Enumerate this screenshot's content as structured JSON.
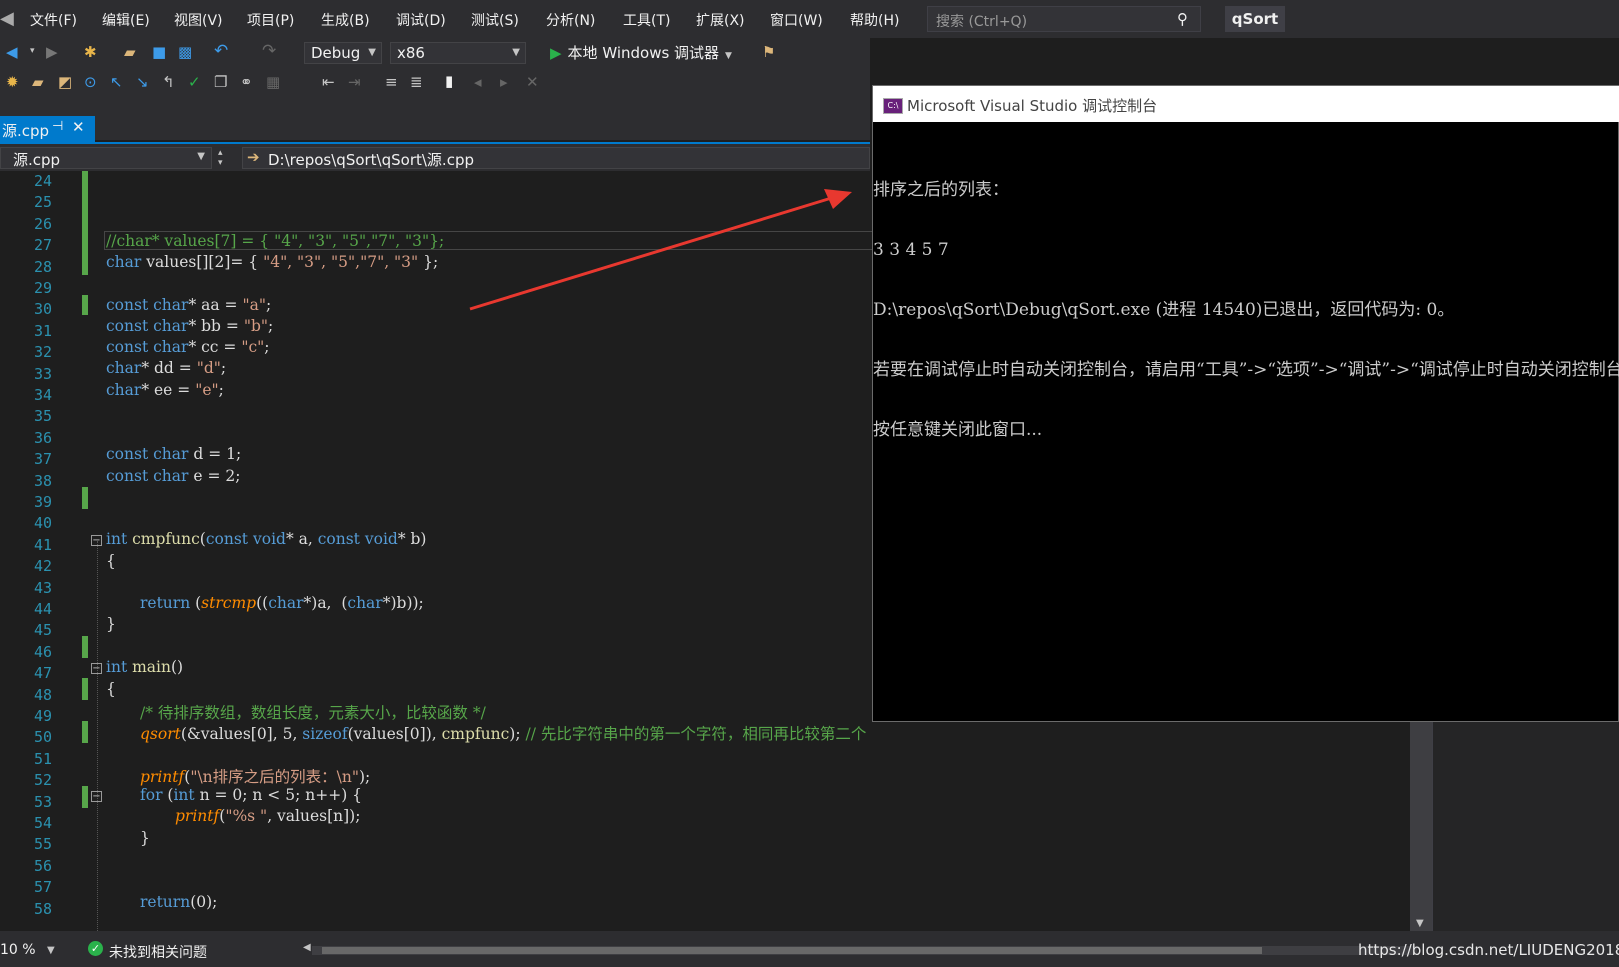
{
  "menu": [
    "文件(F)",
    "编辑(E)",
    "视图(V)",
    "项目(P)",
    "生成(B)",
    "调试(D)",
    "测试(S)",
    "分析(N)",
    "工具(T)",
    "扩展(X)",
    "窗口(W)",
    "帮助(H)"
  ],
  "search": {
    "placeholder": "搜索 (Ctrl+Q)"
  },
  "solution_name": "qSort",
  "toolbar": {
    "config": "Debug",
    "platform": "x86",
    "run_label": "本地 Windows 调试器"
  },
  "tab": {
    "name": "源.cpp",
    "pin": "⊣",
    "close": "✕"
  },
  "nav": {
    "file": "源.cpp",
    "path": "D:\\repos\\qSort\\qSort\\源.cpp"
  },
  "editor": {
    "line_numbers": [
      "24",
      "25",
      "26",
      "27",
      "28",
      "29",
      "30",
      "31",
      "32",
      "33",
      "34",
      "35",
      "36",
      "37",
      "38",
      "39",
      "40",
      "41",
      "42",
      "43",
      "44",
      "45",
      "46",
      "47",
      "48",
      "49",
      "50",
      "51",
      "52",
      "53",
      "54",
      "55",
      "56",
      "57",
      "58"
    ],
    "lines": {
      "l27": "//char* values[7] = { \"4\", \"3\", \"5\",\"7\", \"3\"};",
      "l28_kw": "char",
      "l28_rest": " values[][2]= { ",
      "l28_strs": "\"4\", \"3\", \"5\",\"7\", \"3\"",
      "l28_end": " };",
      "l30": [
        "const",
        "char",
        "* aa = ",
        "\"a\"",
        ";"
      ],
      "l31": [
        "const",
        "char",
        "* bb = ",
        "\"b\"",
        ";"
      ],
      "l32": [
        "const",
        "char",
        "* cc = ",
        "\"c\"",
        ";"
      ],
      "l33": [
        "char",
        "* dd = ",
        "\"d\"",
        ";"
      ],
      "l34": [
        "char",
        "* ee = ",
        "\"e\"",
        ";"
      ],
      "l37": [
        "const",
        "char",
        " d = 1;"
      ],
      "l38": [
        "const",
        "char",
        " e = 2;"
      ],
      "l41": [
        "int",
        "cmpfunc",
        "(",
        "const",
        "void",
        "* a, ",
        "const",
        "void",
        "* b)"
      ],
      "l42": "{",
      "l44": [
        "return",
        " (",
        "strcmp",
        "((",
        "char",
        "*)a,  (",
        "char",
        "*)b));"
      ],
      "l45": "}",
      "l47": [
        "int",
        "main",
        "()"
      ],
      "l48": "{",
      "l49": "/* 待排序数组，数组长度，元素大小，比较函数 */",
      "l50": [
        "qsort",
        "(&values[0], 5, ",
        "sizeof",
        "(values[0]), ",
        "cmpfunc",
        "); ",
        "// 先比字符串中的第一个字符，相同再比较第二个"
      ],
      "l52": [
        "printf",
        "(",
        "\"\\n排序之后的列表：\\n\"",
        ");"
      ],
      "l53": [
        "for",
        " (",
        "int",
        " n = 0; n < 5; n++) {"
      ],
      "l54": [
        "printf",
        "(",
        "\"%s \"",
        ", values[n]);"
      ],
      "l55": "}",
      "l58": [
        "return",
        "(0);"
      ]
    }
  },
  "console": {
    "title": "Microsoft Visual Studio 调试控制台",
    "icon": "C:\\",
    "lines": [
      "排序之后的列表：",
      "3 3 4 5 7",
      "D:\\repos\\qSort\\Debug\\qSort.exe (进程 14540)已退出，返回代码为: 0。",
      "若要在调试停止时自动关闭控制台，请启用“工具”->“选项”->“调试”->“调试停止时自动关闭控制台”。",
      "按任意键关闭此窗口..."
    ]
  },
  "status": {
    "zoom": "10 %",
    "issues": "未找到相关问题",
    "watermark": "https://blog.csdn.net/LIUDENG2018"
  },
  "colors": {
    "accent": "#007acc",
    "keyword": "#569cd6",
    "string": "#d69d85",
    "comment": "#57a64a",
    "arrow": "#e8382f"
  }
}
